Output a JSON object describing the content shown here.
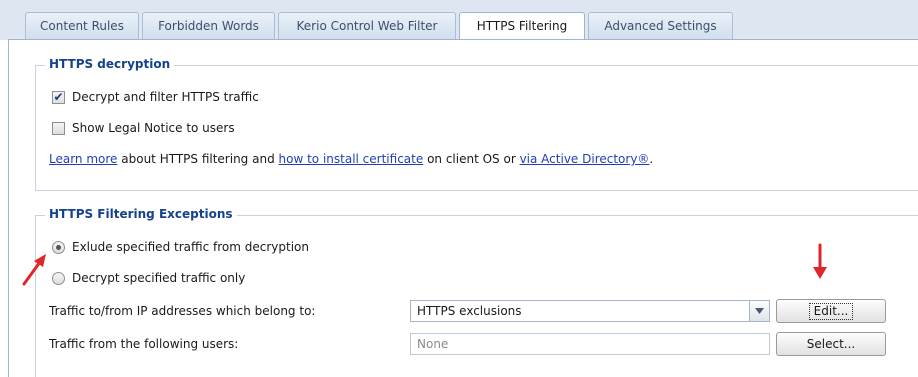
{
  "tabs": [
    {
      "label": "Content Rules",
      "active": false
    },
    {
      "label": "Forbidden Words",
      "active": false
    },
    {
      "label": "Kerio Control Web Filter",
      "active": false
    },
    {
      "label": "HTTPS Filtering",
      "active": true
    },
    {
      "label": "Advanced Settings",
      "active": false
    }
  ],
  "decryption": {
    "legend": "HTTPS decryption",
    "decrypt_checkbox": {
      "label": "Decrypt and filter HTTPS traffic",
      "checked": true
    },
    "legal_checkbox": {
      "label": "Show Legal Notice to users",
      "checked": false
    },
    "info": {
      "learn_more": "Learn more",
      "text1": " about HTTPS filtering and ",
      "install_link": "how to install certificate",
      "text2": " on client OS or ",
      "ad_link": "via Active Directory®",
      "end": "."
    }
  },
  "exceptions": {
    "legend": "HTTPS Filtering Exceptions",
    "radio_exclude": {
      "label": "Exlude specified traffic from decryption",
      "checked": true
    },
    "radio_decrypt": {
      "label": "Decrypt specified traffic only",
      "checked": false
    },
    "ip_label": "Traffic to/from IP addresses which belong to:",
    "ip_value": "HTTPS exclusions",
    "edit_button": "Edit...",
    "users_label": "Traffic from the following users:",
    "users_placeholder": "None",
    "select_button": "Select..."
  },
  "colors": {
    "legend": "#15428b",
    "link": "#1f3fb8",
    "annotation_arrow": "#e0252b"
  },
  "icons": {
    "checkmark": "checkmark-icon",
    "dropdown": "chevron-down-icon",
    "arrow_annotation": "red-arrow-icon"
  }
}
